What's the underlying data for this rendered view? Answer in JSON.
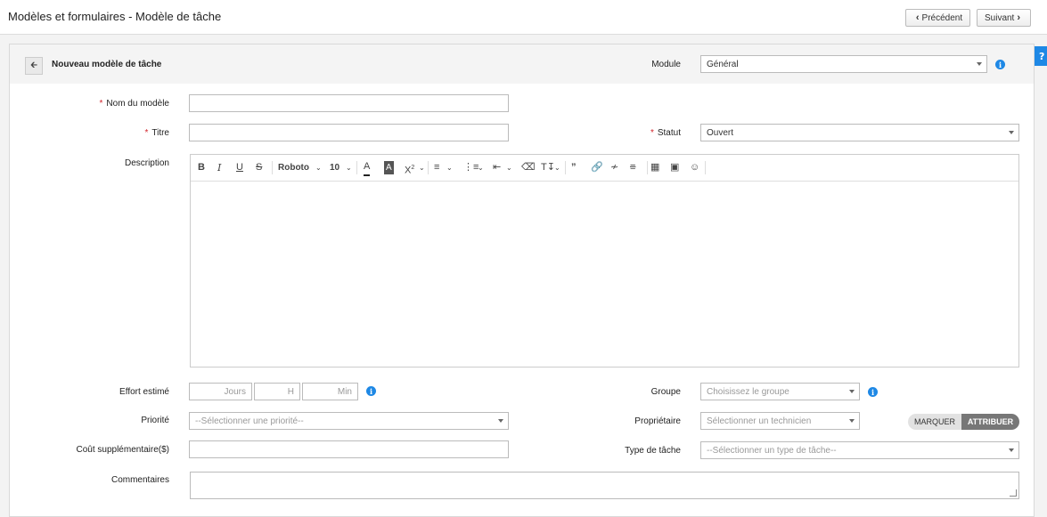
{
  "header": {
    "title": "Modèles et formulaires - Modèle de tâche",
    "prev_label": "Précédent",
    "next_label": "Suivant"
  },
  "panel": {
    "title": "Nouveau modèle de tâche",
    "module_label": "Module",
    "module_value": "Général"
  },
  "form": {
    "template_name_label": "Nom du modèle",
    "title_label": "Titre",
    "status_label": "Statut",
    "status_value": "Ouvert",
    "description_label": "Description",
    "effort_label": "Effort estimé",
    "effort_days_ph": "Jours",
    "effort_hours_ph": "H",
    "effort_min_ph": "Min",
    "group_label": "Groupe",
    "group_ph": "Choisissez le groupe",
    "priority_label": "Priorité",
    "priority_ph": "--Sélectionner une priorité--",
    "owner_label": "Propriétaire",
    "owner_ph": "Sélectionner un technicien",
    "toggle_mark": "MARQUER",
    "toggle_assign": "ATTRIBUER",
    "cost_label": "Coût supplémentaire($)",
    "task_type_label": "Type de tâche",
    "task_type_ph": "--Sélectionner un type de tâche--",
    "comments_label": "Commentaires"
  },
  "editor": {
    "font_name": "Roboto",
    "font_size": "10"
  },
  "colors": {
    "required": "#d2232a",
    "info": "#1e88e5",
    "help_tab": "#1e88e5",
    "toggle_active": "#777777"
  }
}
